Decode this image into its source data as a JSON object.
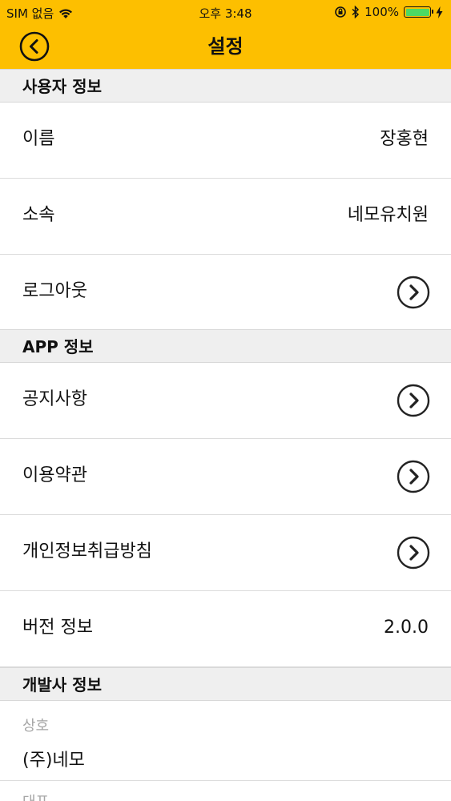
{
  "status_bar": {
    "carrier": "SIM 없음",
    "time": "오후 3:48",
    "battery_percent": "100%",
    "battery_level": 1.0
  },
  "nav": {
    "title": "설정",
    "back_icon": "back-circle-chevron-icon"
  },
  "sections": {
    "user": {
      "header": "사용자 정보",
      "name_label": "이름",
      "name_value": "장홍현",
      "affiliation_label": "소속",
      "affiliation_value": "네모유치원",
      "logout_label": "로그아웃"
    },
    "app": {
      "header": "APP 정보",
      "notice_label": "공지사항",
      "terms_label": "이용약관",
      "privacy_label": "개인정보취급방침",
      "version_label": "버전 정보",
      "version_value": "2.0.0"
    },
    "developer": {
      "header": "개발사 정보",
      "company_caption": "상호",
      "company_value": "(주)네모",
      "ceo_caption": "대표"
    }
  },
  "colors": {
    "accent": "#fdbf00",
    "section_bg": "#efefef",
    "battery_green": "#4cd964"
  }
}
